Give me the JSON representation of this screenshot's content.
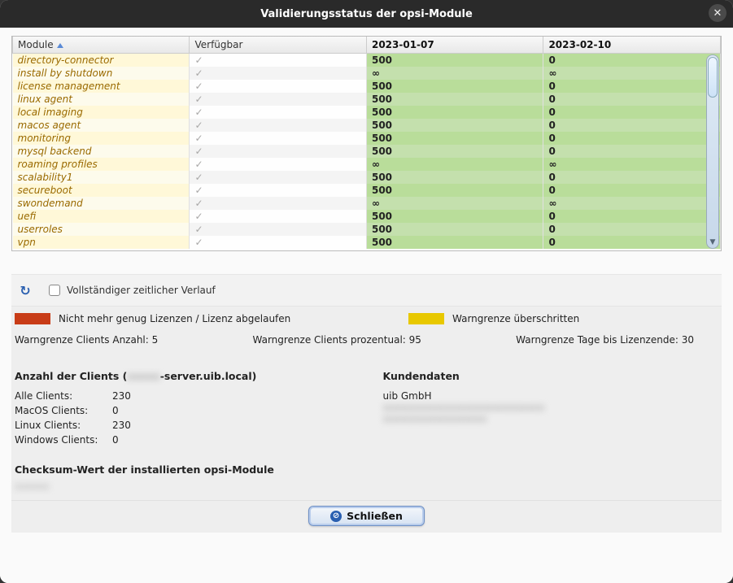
{
  "window": {
    "title": "Validierungsstatus der opsi-Module"
  },
  "table": {
    "columns": {
      "module": "Module",
      "available": "Verfügbar",
      "date1": "2023-01-07",
      "date2": "2023-02-10"
    },
    "rows": [
      {
        "module": "directory-connector",
        "available": "check",
        "v1": "500",
        "v2": "0"
      },
      {
        "module": "install by shutdown",
        "available": "check",
        "v1": "∞",
        "v2": "∞"
      },
      {
        "module": "license management",
        "available": "check",
        "v1": "500",
        "v2": "0"
      },
      {
        "module": "linux agent",
        "available": "check",
        "v1": "500",
        "v2": "0"
      },
      {
        "module": "local imaging",
        "available": "check",
        "v1": "500",
        "v2": "0"
      },
      {
        "module": "macos agent",
        "available": "check",
        "v1": "500",
        "v2": "0"
      },
      {
        "module": "monitoring",
        "available": "check",
        "v1": "500",
        "v2": "0"
      },
      {
        "module": "mysql backend",
        "available": "check",
        "v1": "500",
        "v2": "0"
      },
      {
        "module": "roaming profiles",
        "available": "check",
        "v1": "∞",
        "v2": "∞"
      },
      {
        "module": "scalability1",
        "available": "check",
        "v1": "500",
        "v2": "0"
      },
      {
        "module": "secureboot",
        "available": "check",
        "v1": "500",
        "v2": "0"
      },
      {
        "module": "swondemand",
        "available": "check",
        "v1": "∞",
        "v2": "∞"
      },
      {
        "module": "uefi",
        "available": "check",
        "v1": "500",
        "v2": "0"
      },
      {
        "module": "userroles",
        "available": "check",
        "v1": "500",
        "v2": "0"
      },
      {
        "module": "vpn",
        "available": "check",
        "v1": "500",
        "v2": "0"
      }
    ]
  },
  "controls": {
    "full_timeline_label": "Vollständiger zeitlicher Verlauf",
    "full_timeline_checked": false
  },
  "legend": {
    "red_label": "Nicht mehr genug Lizenzen / Lizenz abgelaufen",
    "yellow_label": "Warngrenze überschritten",
    "warn_clients_count_label": "Warngrenze Clients Anzahl:",
    "warn_clients_count_value": "5",
    "warn_clients_pct_label": "Warngrenze Clients prozentual:",
    "warn_clients_pct_value": "95",
    "warn_days_label": "Warngrenze Tage bis Lizenzende:",
    "warn_days_value": "30"
  },
  "clients": {
    "heading_prefix": "Anzahl der Clients (",
    "heading_server_hidden": "xxxxx",
    "heading_server_suffix": "-server.uib.local)",
    "all_label": "Alle Clients:",
    "all_value": "230",
    "macos_label": "MacOS Clients:",
    "macos_value": "0",
    "linux_label": "Linux Clients:",
    "linux_value": "230",
    "windows_label": "Windows Clients:",
    "windows_value": "0"
  },
  "customer": {
    "heading": "Kundendaten",
    "name": "uib GmbH",
    "hidden1": "xxxxxxxxxxxxxxxxxxxxxxxxxxxx",
    "hidden2": "xxxxxxxxxxxxxxxxxx"
  },
  "checksum": {
    "heading": "Checksum-Wert der installierten opsi-Module",
    "value_hidden": "xxxxxx"
  },
  "buttons": {
    "close": "Schließen"
  }
}
